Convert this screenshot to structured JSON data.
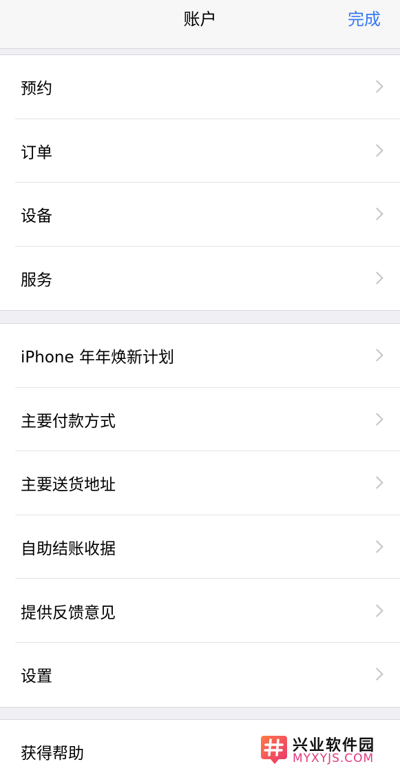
{
  "nav": {
    "title": "账户",
    "done_label": "完成"
  },
  "groups": [
    {
      "items": [
        {
          "label": "预约"
        },
        {
          "label": "订单"
        },
        {
          "label": "设备"
        },
        {
          "label": "服务"
        }
      ]
    },
    {
      "items": [
        {
          "label": "iPhone 年年焕新计划"
        },
        {
          "label": "主要付款方式"
        },
        {
          "label": "主要送货地址"
        },
        {
          "label": "自助结账收据"
        },
        {
          "label": "提供反馈意见"
        },
        {
          "label": "设置"
        }
      ]
    },
    {
      "items": [
        {
          "label": "获得帮助"
        }
      ]
    }
  ],
  "watermark": {
    "title": "兴业软件园",
    "subtitle": "MYXYJS.COM"
  },
  "colors": {
    "accent": "#3478f6",
    "background": "#efeff4",
    "chevron": "#c4c4c7"
  }
}
